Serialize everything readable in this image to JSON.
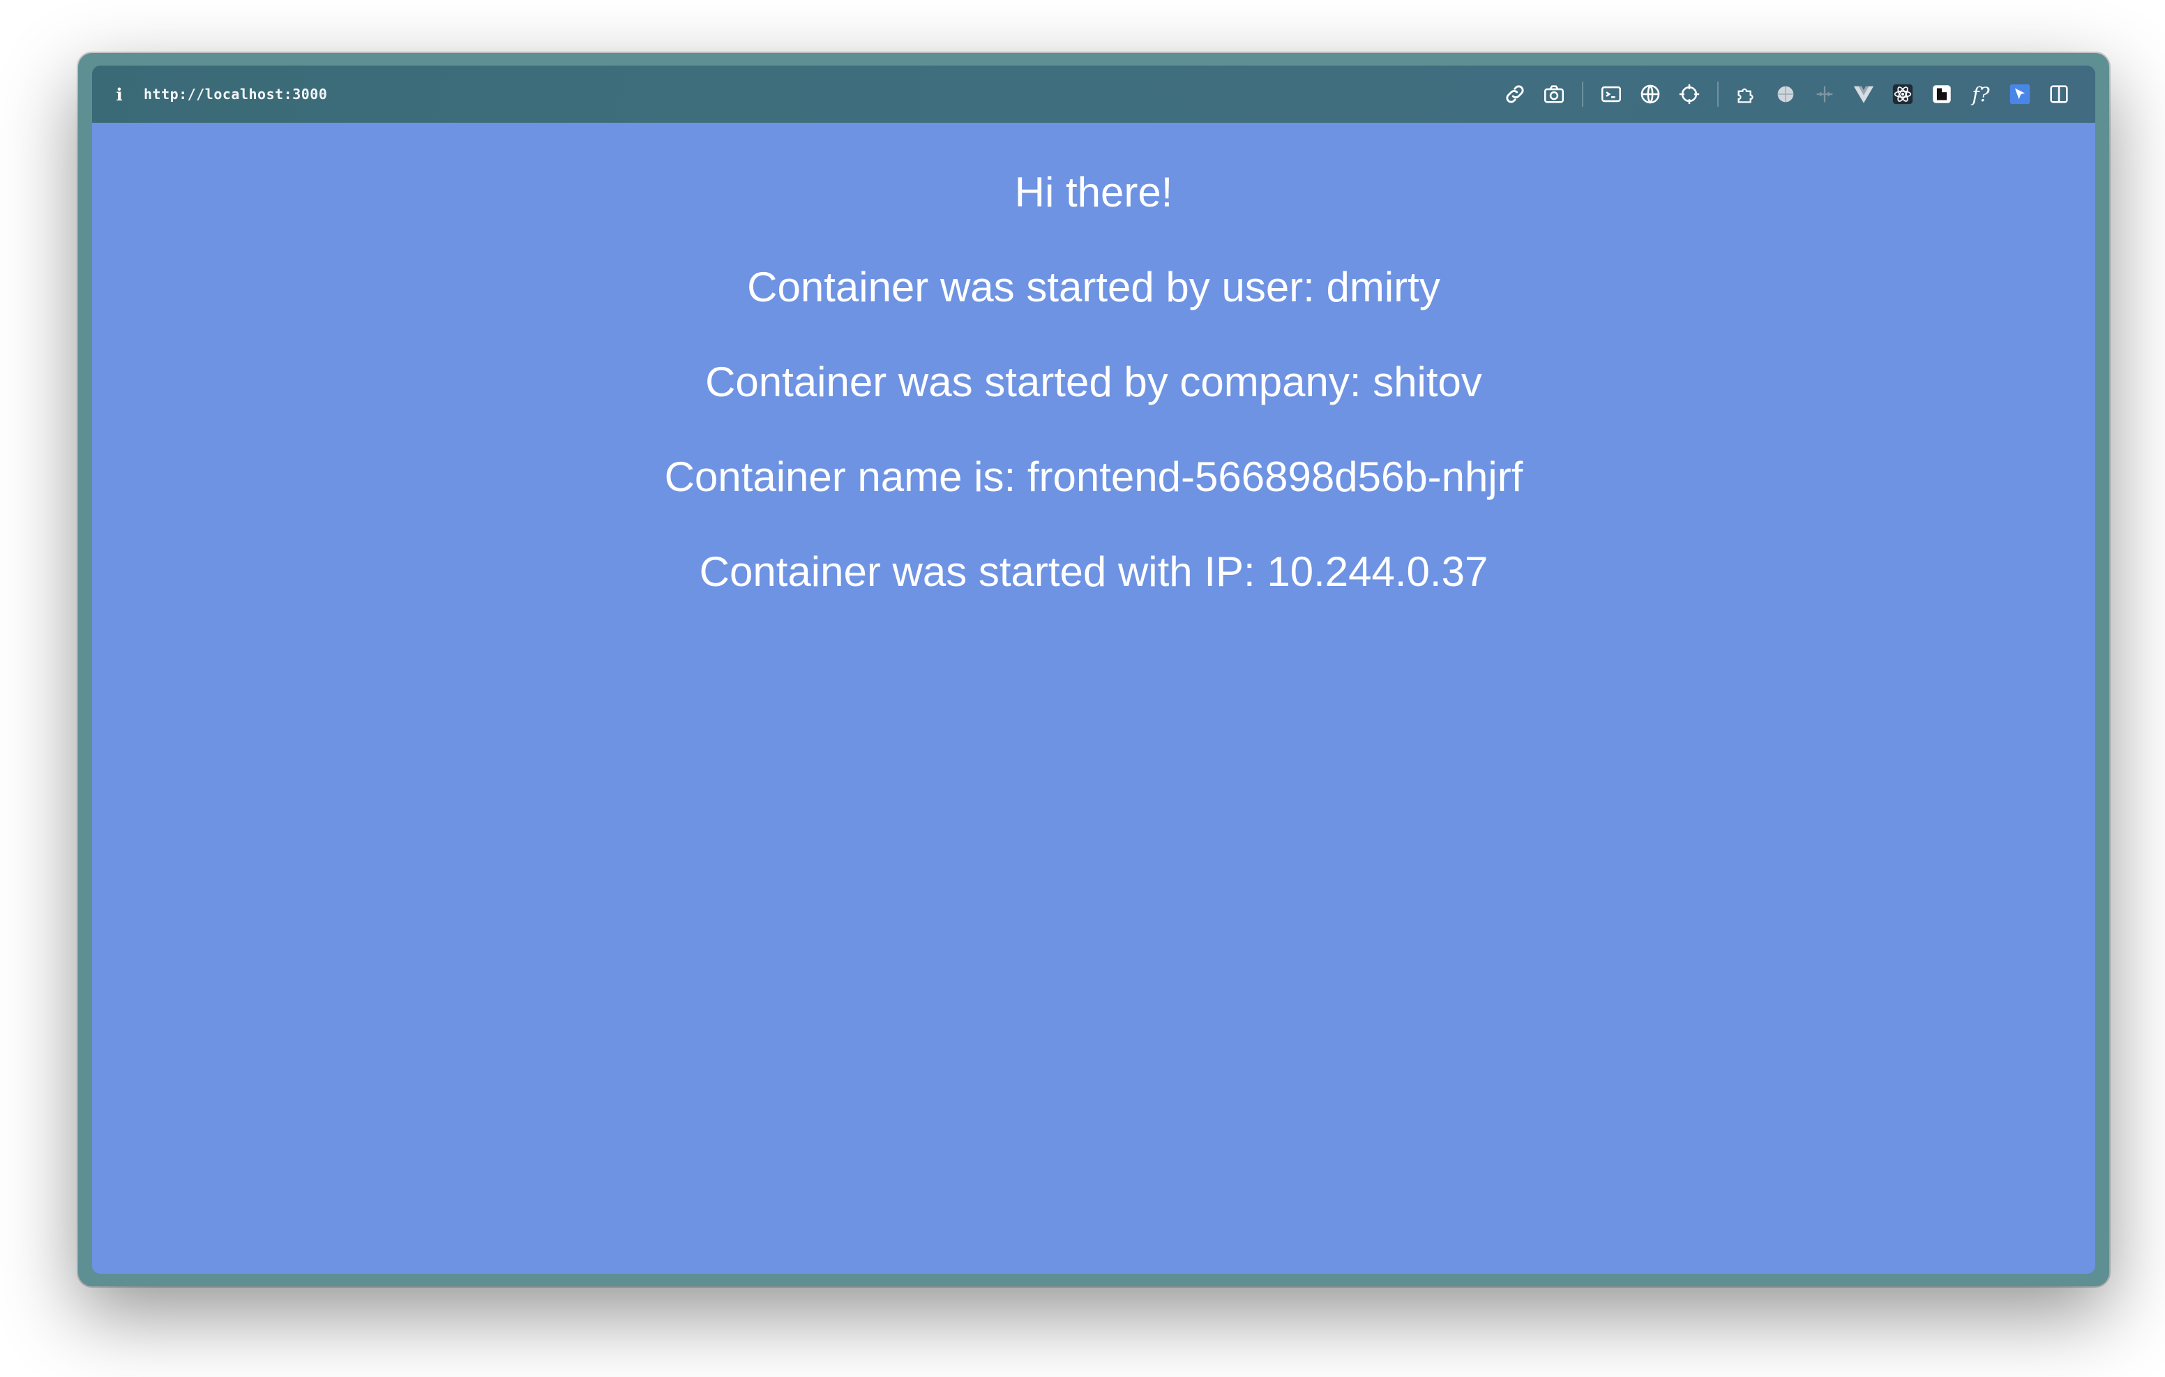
{
  "browser": {
    "url": "http://localhost:3000",
    "info_icon": "i",
    "toolbar_icons": [
      "link-icon",
      "camera-icon",
      "terminal-icon",
      "globe-icon",
      "crosshair-icon",
      "puzzle-icon",
      "sphere-icon",
      "ruler-icon",
      "vue-icon",
      "react-icon",
      "contrast-icon",
      "function-icon",
      "cursor-icon",
      "split-view-icon"
    ],
    "function_glyph": "f?"
  },
  "page": {
    "greeting": "Hi there!",
    "user_line": "Container was started by user: dmirty",
    "company_line": "Container was started by company: shitov",
    "name_line": "Container name is: frontend-566898d56b-nhjrf",
    "ip_line": "Container was started with IP: 10.244.0.37"
  },
  "colors": {
    "page_background": "#6e93e3",
    "toolbar_background": "#3d6c7b",
    "text": "#ffffff"
  }
}
